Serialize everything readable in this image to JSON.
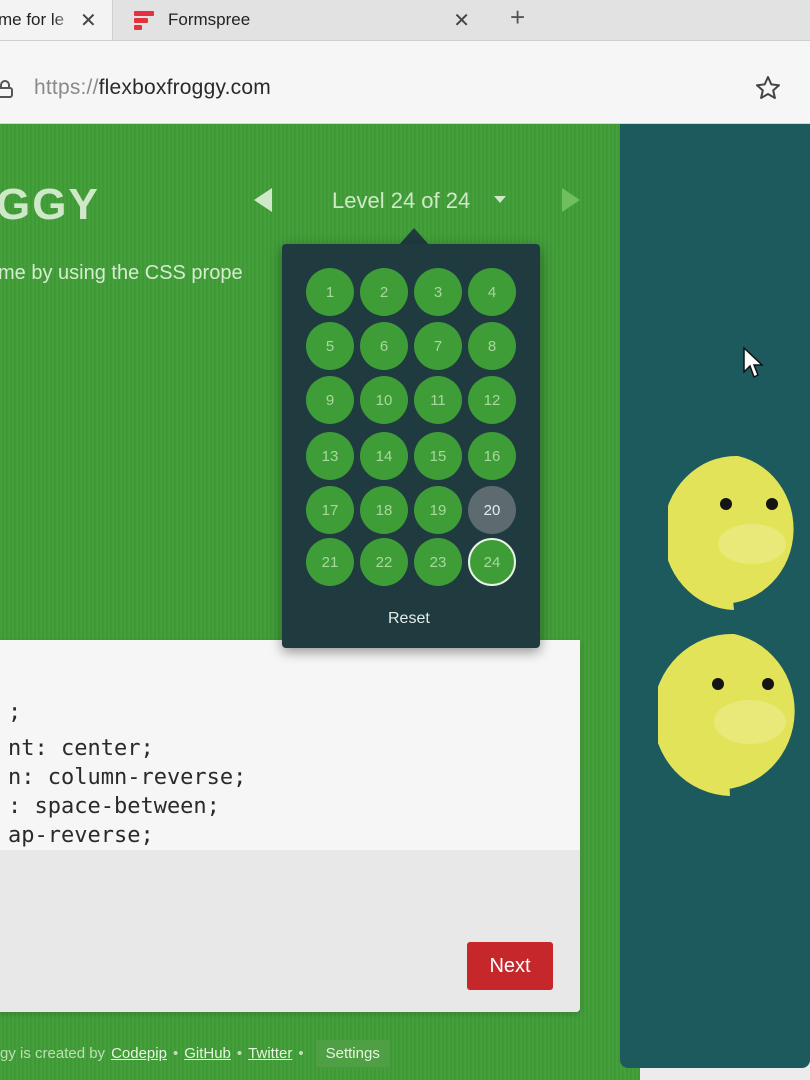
{
  "browser": {
    "tabs": [
      {
        "title": "me for le",
        "close_icon": "close-icon"
      },
      {
        "title": "Formspree",
        "close_icon": "close-icon"
      }
    ],
    "new_tab": "+",
    "url_protocol": "https://",
    "url_host": "flexboxfroggy.com"
  },
  "header": {
    "logo_fragment": "GGY",
    "level_label": "Level 24 of 24"
  },
  "instructions_fragment": "me by using the CSS prope",
  "editor": {
    "lines": [
      ";",
      "nt: center;",
      "n: column-reverse;",
      ": space-between;",
      "ap-reverse;"
    ],
    "next_label": "Next"
  },
  "level_menu": {
    "levels": [
      "1",
      "2",
      "3",
      "4",
      "5",
      "6",
      "7",
      "8",
      "9",
      "10",
      "11",
      "12",
      "13",
      "14",
      "15",
      "16",
      "17",
      "18",
      "19",
      "20",
      "21",
      "22",
      "23",
      "24"
    ],
    "unsolved": [
      "20"
    ],
    "current": "24",
    "reset_label": "Reset"
  },
  "footer": {
    "prefix": "gy is created by",
    "links": [
      "Codepip",
      "GitHub",
      "Twitter"
    ],
    "separator": "•",
    "settings_label": "Settings"
  },
  "colors": {
    "page_green": "#3e9a35",
    "pond": "#1d5a5e",
    "popup": "#1f3b40",
    "solved_level": "#3f9d38",
    "unsolved_level": "#5d6b70",
    "next_button": "#c6272b",
    "lilypad": "#e3e35a"
  }
}
